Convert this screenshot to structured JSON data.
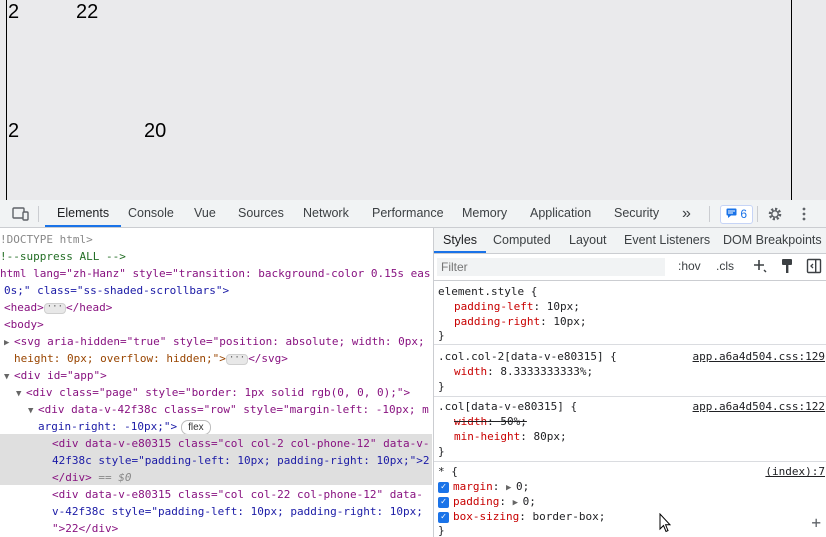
{
  "viewport": {
    "rows": [
      {
        "col_a": "2",
        "col_b": "22"
      },
      {
        "col_a": "2",
        "col_b": "20"
      }
    ]
  },
  "toolbar": {
    "tabs": [
      "Elements",
      "Console",
      "Vue",
      "Sources",
      "Network",
      "Performance",
      "Memory",
      "Application",
      "Security"
    ],
    "active_tab": "Elements",
    "more_tabs": "»",
    "issues_count": "6",
    "icons": [
      "device-toolbar-icon",
      "issues-icon",
      "settings-gear-icon",
      "more-vertical-icon"
    ]
  },
  "dom": {
    "lines": [
      "!DOCTYPE html>",
      "!--suppress ALL -->",
      "html lang=\"zh-Hanz\" style=\"transition: background-color 0.15s eas",
      "0s;\" class=\"ss-shaded-scrollbars\">",
      "<head>",
      "</head>",
      "<body>",
      "<svg aria-hidden=\"true\" style=\"position: absolute; width: 0px;",
      "height: 0px; overflow: hidden;\">",
      "</svg>",
      "<div id=\"app\">",
      "<div class=\"page\" style=\"border: 1px solid rgb(0, 0, 0);\">",
      "<div data-v-42f38c class=\"row\" style=\"margin-left: -10px; m",
      "argin-right: -10px;\">",
      "flex",
      "<div data-v-e80315 class=\"col col-2 col-phone-12\" data-v-",
      "42f38c style=\"padding-left: 10px; padding-right: 10px;\">2",
      "</div>",
      "== $0",
      "<div data-v-e80315 class=\"col col-22 col-phone-12\" data-",
      "v-42f38c style=\"padding-left: 10px; padding-right: 10px;",
      "\">22</div>"
    ]
  },
  "styles": {
    "tabs": [
      "Styles",
      "Computed",
      "Layout",
      "Event Listeners",
      "DOM Breakpoints"
    ],
    "active_tab": "Styles",
    "filter_placeholder": "Filter",
    "hov": ":hov",
    "cls": ".cls",
    "rules": [
      {
        "selector": "element.style {",
        "source": "",
        "props": [
          {
            "name": "padding-left",
            "value": "10px;"
          },
          {
            "name": "padding-right",
            "value": "10px;"
          }
        ]
      },
      {
        "selector": ".col.col-2[data-v-e80315] {",
        "source": "app.a6a4d504.css:129",
        "props": [
          {
            "name": "width",
            "value": "8.3333333333%;"
          }
        ]
      },
      {
        "selector": ".col[data-v-e80315] {",
        "source": "app.a6a4d504.css:122",
        "props": [
          {
            "name": "width",
            "value": "50%;",
            "overridden": true
          },
          {
            "name": "min-height",
            "value": "80px;"
          }
        ]
      },
      {
        "selector": "* {",
        "source": "(index):7",
        "props": [
          {
            "name": "margin",
            "value": "0;"
          },
          {
            "name": "padding",
            "value": "0;"
          },
          {
            "name": "box-sizing",
            "value": "border-box;"
          }
        ]
      }
    ],
    "close_brace": "}"
  },
  "colors": {
    "accent": "#1a73e8",
    "tag": "#881280",
    "attr_name": "#994500",
    "attr_value": "#1a1aa6",
    "css_prop": "#c80000",
    "viewport_bg": "#eaeaec"
  }
}
